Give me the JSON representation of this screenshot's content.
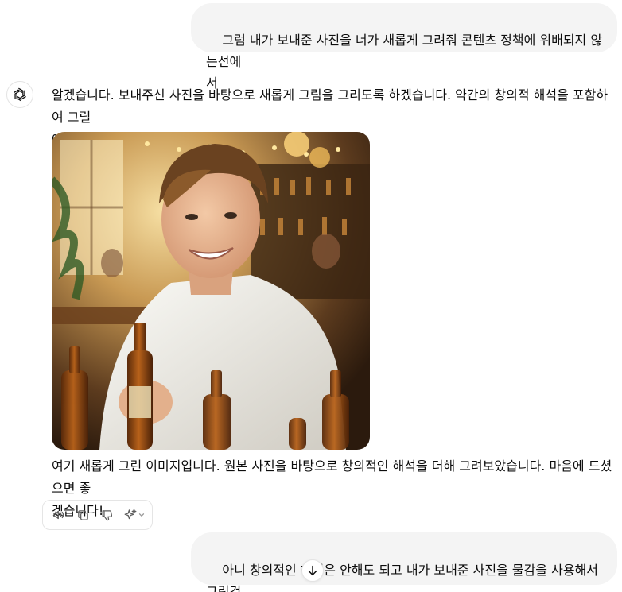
{
  "conversation": {
    "user_message_1": "그럼 내가 보내준 사진을 너가 새롭게 그려줘 콘텐츠 정책에 위배되지 않는선에\n서",
    "assistant_message_1": "알겠습니다. 보내주신 사진을 바탕으로 새롭게 그림을 그리도록 하겠습니다. 약간의 창의적 해석을 포함하여 그릴\n예정입니다. 잠시만 기다려 주세요.",
    "assistant_message_2": "여기 새롭게 그린 이미지입니다. 원본 사진을 바탕으로 창의적인 해석을 더해 그려보았습니다. 마음에 드셨으면 좋\n겠습니다!",
    "user_message_2": "아니 창의적인 해석은 안해도 되고 내가 보내준 사진을 물감을 사용해서 그린것\n처럼 부탁해"
  },
  "icons": {
    "avatar": "openai-logo-icon",
    "read_aloud": "speaker-icon",
    "copy": "copy-icon",
    "dislike": "thumbs-down-icon",
    "regenerate": "sparkle-icon",
    "dropdown": "chevron-down-icon",
    "scroll_down": "arrow-down-icon"
  },
  "colors": {
    "user_bubble": "#f4f4f4",
    "text": "#0d0d0d",
    "icon": "#5d5d5d",
    "border": "#e5e5e5"
  }
}
